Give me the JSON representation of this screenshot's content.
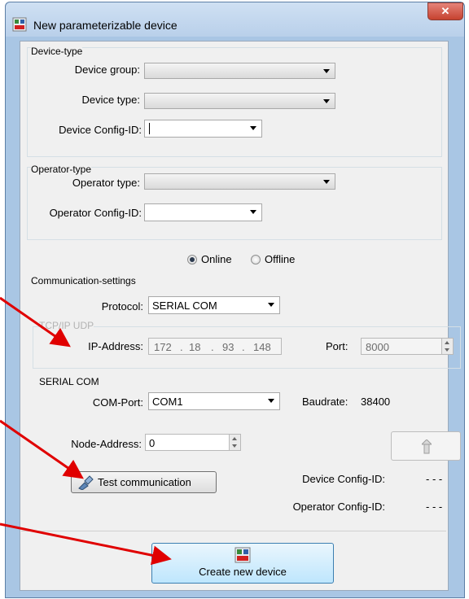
{
  "window": {
    "title": "New parameterizable device",
    "close_glyph": "✕",
    "app_icon": "keb-device-icon"
  },
  "device_type": {
    "group_label": "Device-type",
    "device_group_label": "Device group:",
    "device_group_value": "",
    "device_type_label": "Device type:",
    "device_type_value": "",
    "config_id_label": "Device Config-ID:",
    "config_id_value": ""
  },
  "operator_type": {
    "group_label": "Operator-type",
    "operator_type_label": "Operator type:",
    "operator_type_value": "",
    "config_id_label": "Operator Config-ID:",
    "config_id_value": ""
  },
  "mode": {
    "online_label": "Online",
    "offline_label": "Offline",
    "selected": "Online"
  },
  "communication": {
    "group_label": "Communication-settings",
    "protocol_label": "Protocol:",
    "protocol_value": "SERIAL COM",
    "tcpip": {
      "group_label": "TCP/IP UDP",
      "ip_label": "IP-Address:",
      "ip_octets": [
        "172",
        "18",
        "93",
        "148"
      ],
      "port_label": "Port:",
      "port_value": "8000"
    },
    "serial": {
      "group_label": "SERIAL COM",
      "com_port_label": "COM-Port:",
      "com_port_value": "COM1",
      "baudrate_label": "Baudrate:",
      "baudrate_value": "38400"
    },
    "node_address_label": "Node-Address:",
    "node_address_value": "0",
    "test_button_label": "Test communication",
    "status": {
      "device_config_label": "Device Config-ID:",
      "device_config_value": "- - -",
      "operator_config_label": "Operator Config-ID:",
      "operator_config_value": "- - -"
    }
  },
  "create_button_label": "Create new device",
  "annotation_color": "#e00000"
}
